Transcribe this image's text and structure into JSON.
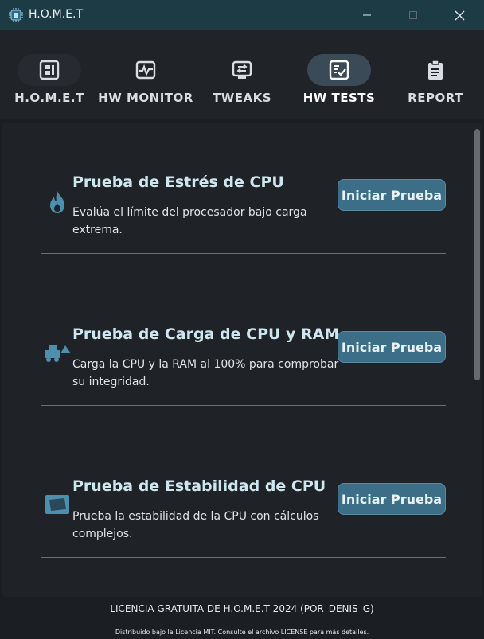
{
  "window": {
    "title": "H.O.M.E.T",
    "icons": {
      "app": "chip-icon",
      "minimize": "minimize-icon",
      "maximize": "maximize-icon",
      "close": "close-icon"
    }
  },
  "nav": {
    "items": [
      {
        "label": "H.O.M.E.T",
        "icon": "cpu-chip-icon"
      },
      {
        "label": "HW MONITOR",
        "icon": "pulse-monitor-icon"
      },
      {
        "label": "TWEAKS",
        "icon": "swap-arrows-icon"
      },
      {
        "label": "HW TESTS",
        "icon": "checklist-icon",
        "active": true
      },
      {
        "label": "REPORT",
        "icon": "clipboard-icon"
      }
    ]
  },
  "tests": [
    {
      "title": "Prueba de Estrés de CPU",
      "description": "Evalúa el límite del procesador bajo carga extrema.",
      "button": "Iniciar Prueba",
      "icon": "fire-icon"
    },
    {
      "title": "Prueba de Carga de CPU y RAM",
      "description": "Carga la CPU y la RAM al 100% para comprobar su integridad.",
      "button": "Iniciar Prueba",
      "icon": "truck-load-icon"
    },
    {
      "title": "Prueba de Estabilidad de CPU",
      "description": "Prueba la estabilidad de la CPU con cálculos complejos.",
      "button": "Iniciar Prueba",
      "icon": "screen-icon"
    }
  ],
  "footer": {
    "license": "LICENCIA GRATUITA DE H.O.M.E.T 2024 (POR_DENIS_G)",
    "note": "Distribuido bajo la Licencia MIT. Consulte el archivo LICENSE para más detalles."
  },
  "colors": {
    "titlebar": "#1d3b45",
    "accent": "#3c6e88",
    "heading": "#cde6ef",
    "icon": "#4d8fae",
    "divider": "#4a7a8f"
  }
}
